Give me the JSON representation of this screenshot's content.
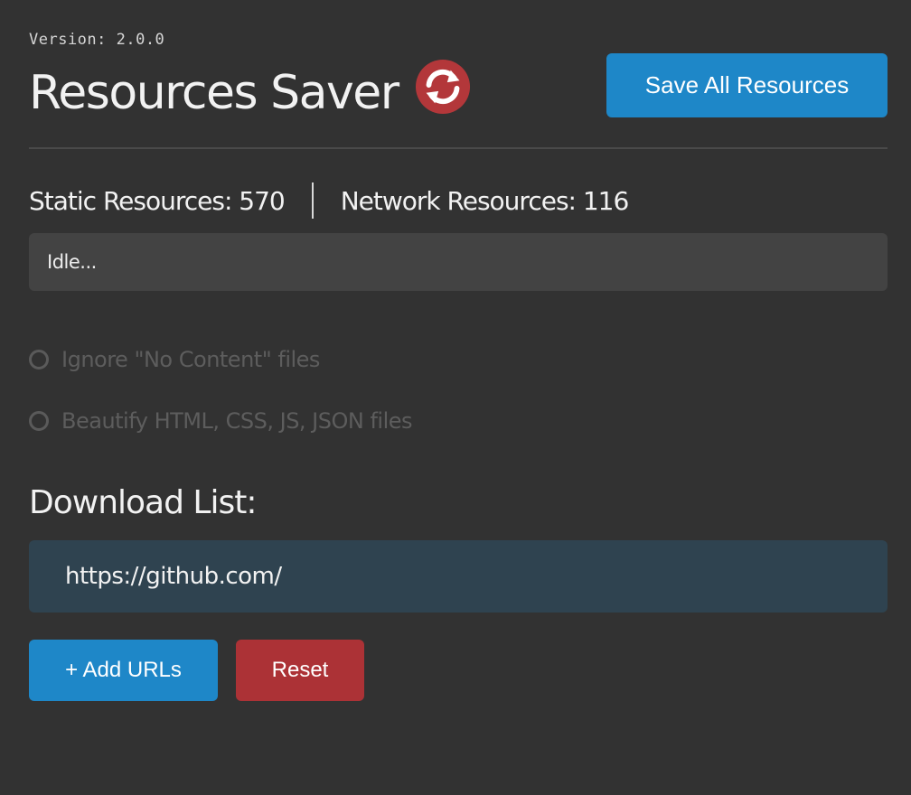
{
  "header": {
    "version": "Version: 2.0.0",
    "title": "Resources Saver",
    "sync_icon": "sync-icon",
    "save_all_label": "Save All Resources"
  },
  "stats": {
    "static_label": "Static Resources: 570",
    "network_label": "Network Resources: 116"
  },
  "status": {
    "text": "Idle..."
  },
  "options": [
    {
      "label": "Ignore \"No Content\" files",
      "checked": false
    },
    {
      "label": "Beautify HTML, CSS, JS, JSON files",
      "checked": false
    }
  ],
  "download_list": {
    "heading": "Download List:",
    "urls": [
      "https://github.com/"
    ]
  },
  "actions": {
    "add_urls_label": "+ Add URLs",
    "reset_label": "Reset"
  },
  "colors": {
    "background": "#323232",
    "primary_button": "#1e87c8",
    "danger_button": "#ac3236",
    "sync_icon": "#b3373a",
    "status_box": "#434343",
    "url_list": "#2f4350"
  }
}
